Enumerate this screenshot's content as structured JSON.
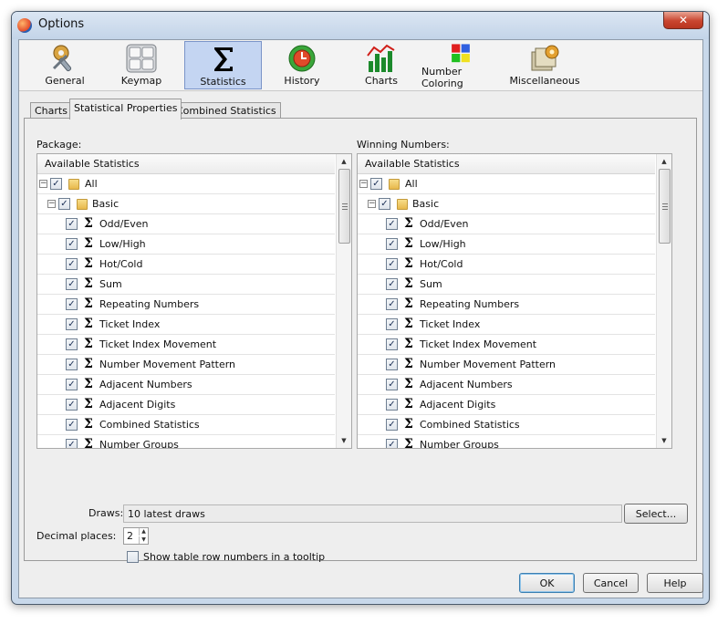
{
  "window": {
    "title": "Options",
    "close_label": "✕"
  },
  "toolbar": {
    "items": [
      {
        "label": "General",
        "icon": "tools-icon"
      },
      {
        "label": "Keymap",
        "icon": "keyboard-icon"
      },
      {
        "label": "Statistics",
        "icon": "sigma-icon"
      },
      {
        "label": "History",
        "icon": "history-icon"
      },
      {
        "label": "Charts",
        "icon": "bar-chart-icon"
      },
      {
        "label": "Number Coloring",
        "icon": "color-grid-icon"
      },
      {
        "label": "Miscellaneous",
        "icon": "misc-icon"
      }
    ],
    "active": "Statistics"
  },
  "tabs": [
    "Charts",
    "Statistical Properties",
    "Combined Statistics"
  ],
  "active_tab": "Statistical Properties",
  "package": {
    "label": "Package:",
    "header": "Available Statistics"
  },
  "winning": {
    "label": "Winning Numbers:",
    "header": "Available Statistics"
  },
  "tree": {
    "root": "All",
    "group": "Basic",
    "items": [
      "Odd/Even",
      "Low/High",
      "Hot/Cold",
      "Sum",
      "Repeating Numbers",
      "Ticket Index",
      "Ticket Index Movement",
      "Number Movement Pattern",
      "Adjacent Numbers",
      "Adjacent Digits",
      "Combined Statistics",
      "Number Groups"
    ]
  },
  "form": {
    "draws_label": "Draws:",
    "draws_value": "10 latest draws",
    "select_label": "Select...",
    "decimal_label": "Decimal places:",
    "decimal_value": "2",
    "tooltip_label": "Show table row numbers in a tooltip"
  },
  "buttons": {
    "ok": "OK",
    "cancel": "Cancel",
    "help": "Help"
  },
  "colors": {
    "selection": "#c4d5f2",
    "frame": "#c8d8ea"
  }
}
